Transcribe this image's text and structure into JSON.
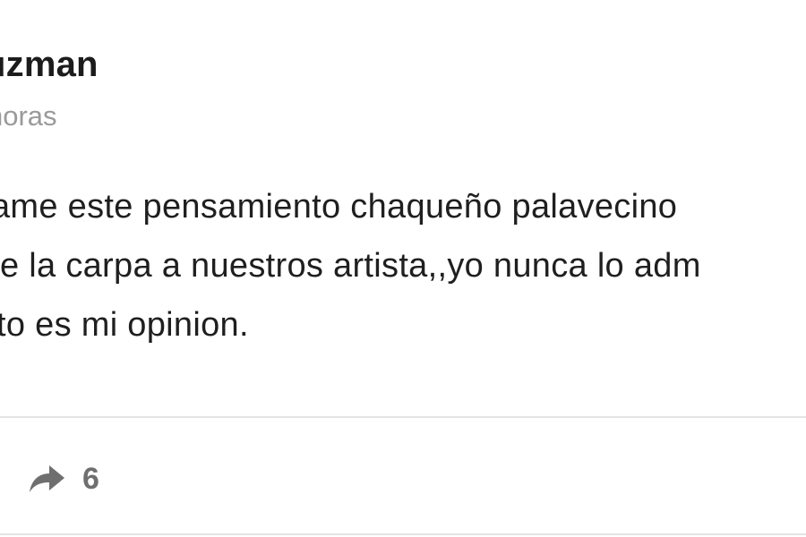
{
  "post": {
    "author_name": "uzman",
    "timestamp": "horas",
    "body_lines": [
      "ame este pensamiento chaqueño palavecino",
      "e la carpa a nuestros artista,,yo nunca lo adm",
      "to es mi opinion."
    ]
  },
  "actions": {
    "share_count": "6",
    "share_icon": "share-arrow-icon"
  },
  "colors": {
    "author": "#1c1c1c",
    "timestamp": "#9a9a9a",
    "body": "#1f1f1f",
    "share": "#6f6f6f",
    "divider": "#e4e4e4"
  }
}
